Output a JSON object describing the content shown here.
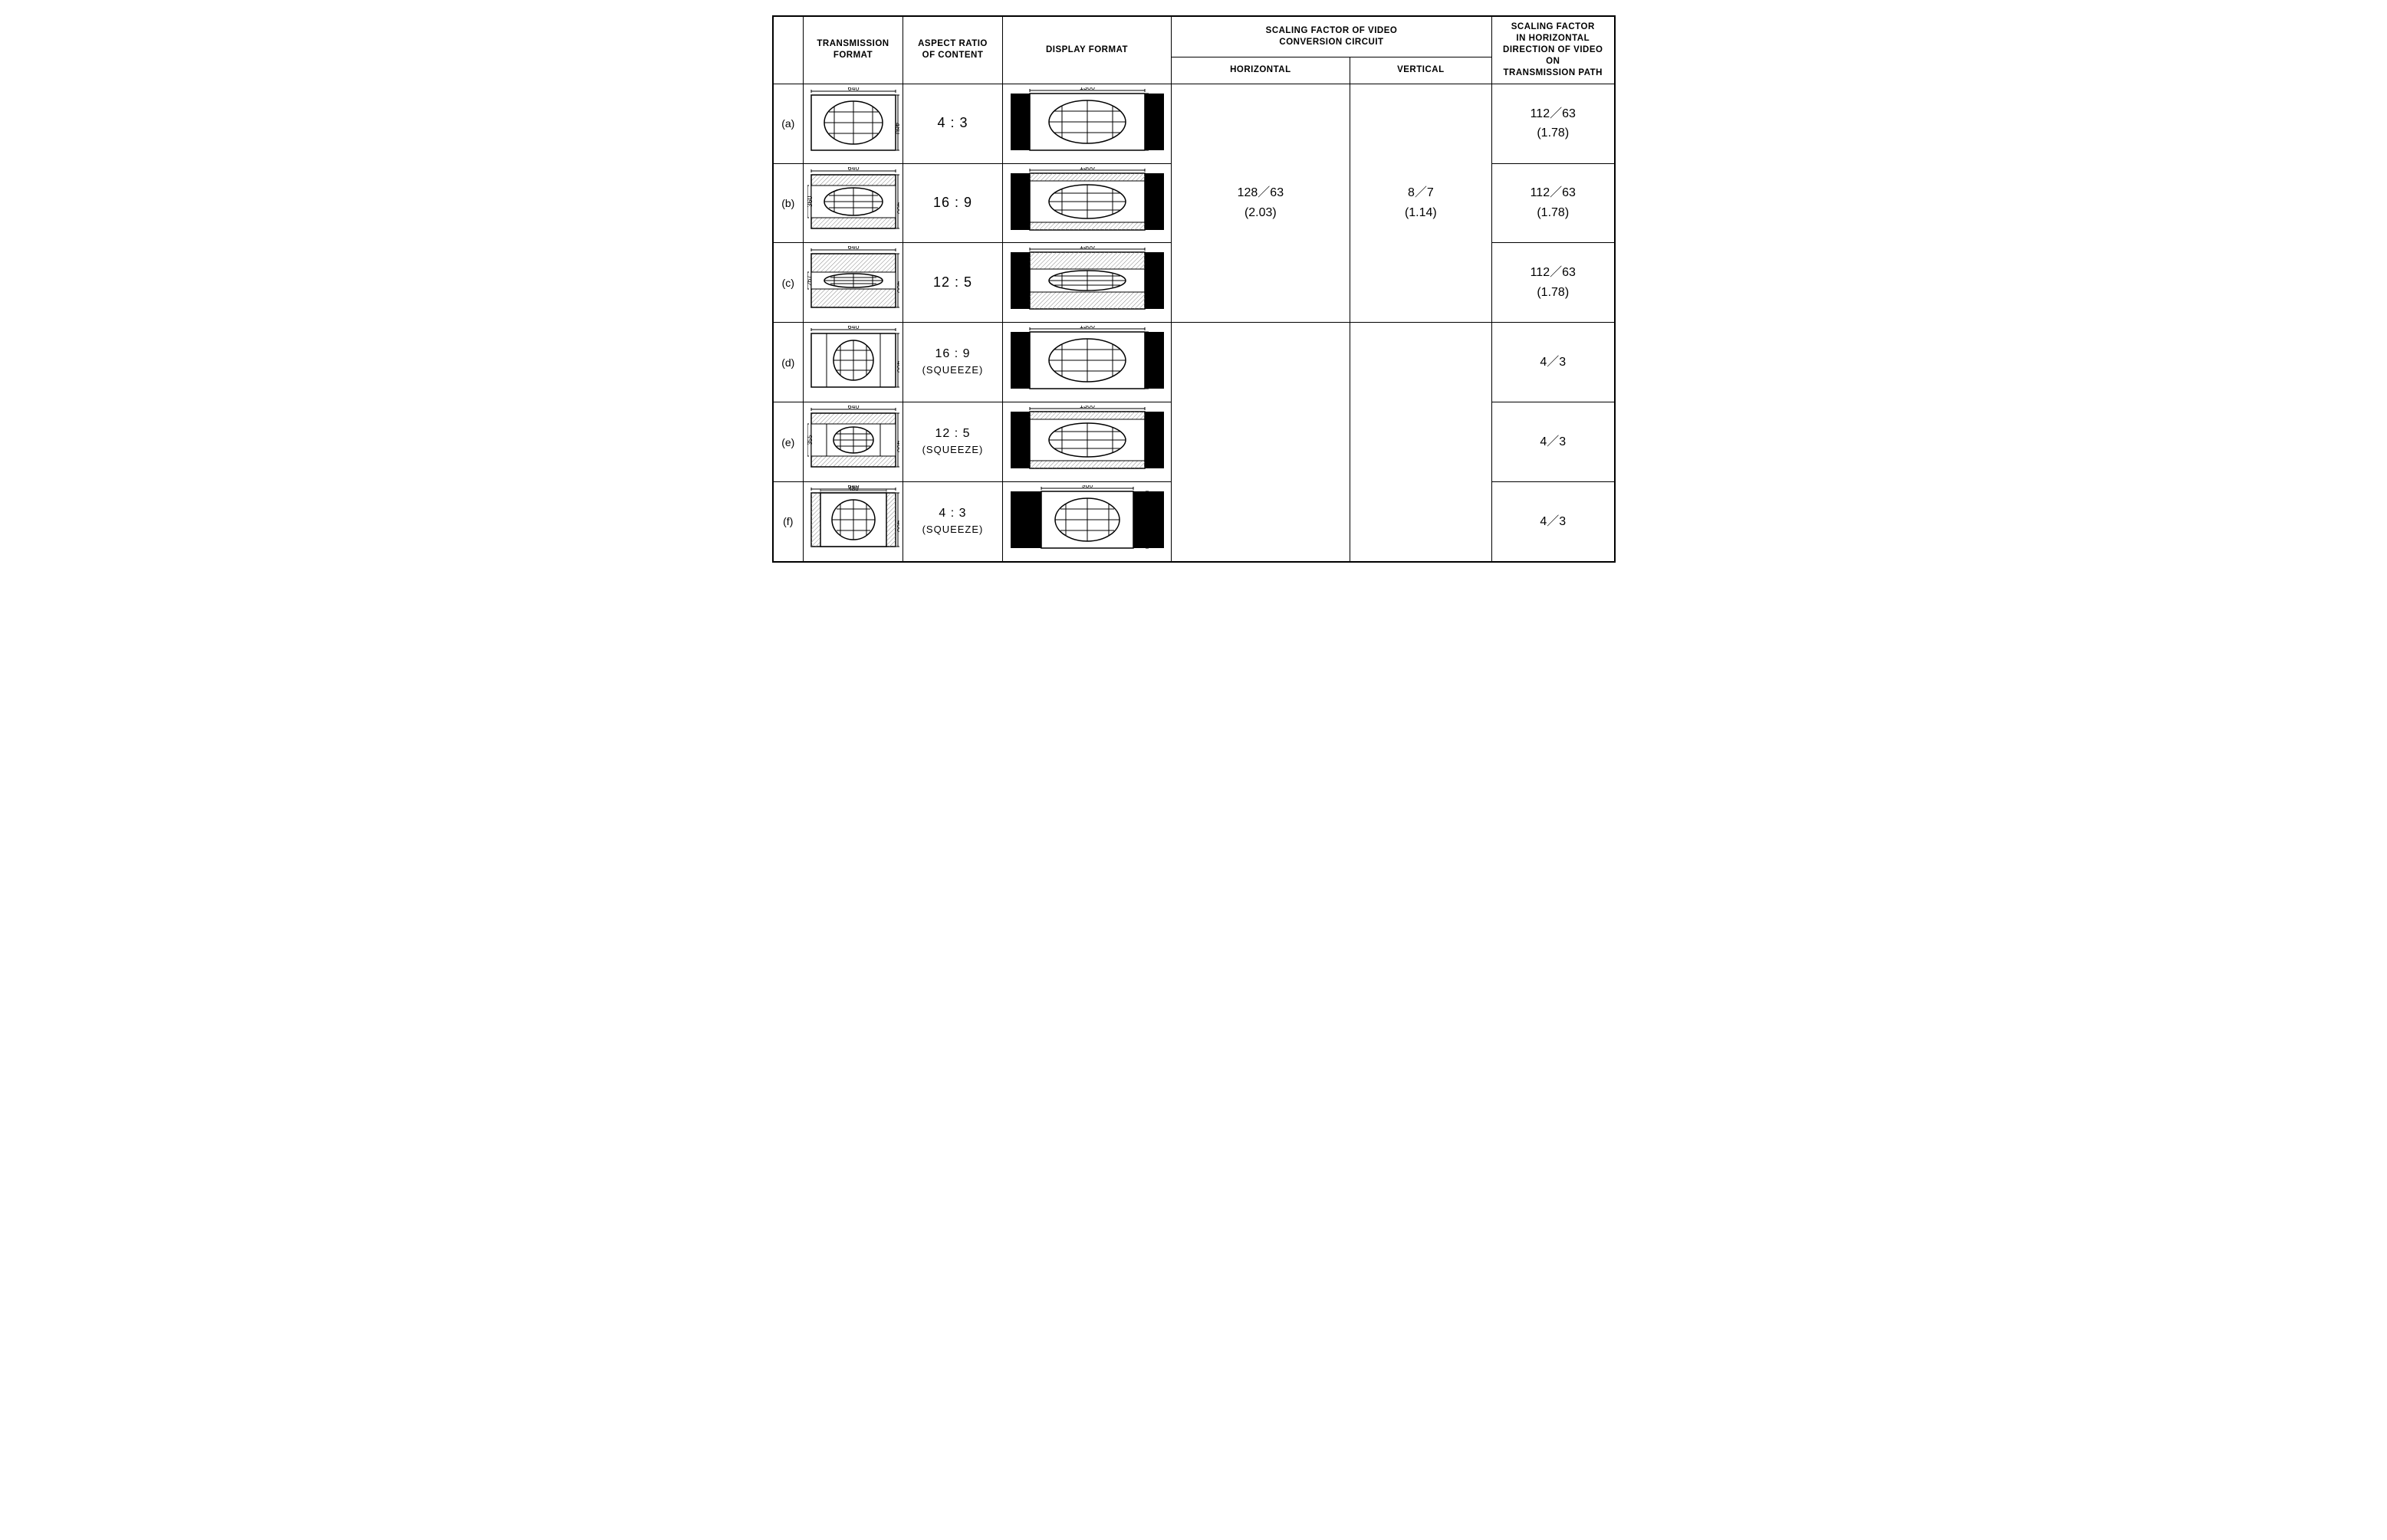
{
  "table": {
    "headers": {
      "col1": "TRANSMISSION\nFORMAT",
      "col2": "ASPECT RATIO\nOF CONTENT",
      "col3": "DISPLAY FORMAT",
      "col4_top": "SCALING FACTOR OF VIDEO\nCONVERSION CIRCUIT",
      "col4_h": "HORIZONTAL",
      "col4_v": "VERTICAL",
      "col5": "SCALING FACTOR\nIN HORIZONTAL\nDIRECTION OF VIDEO ON\nTRANSMISSION PATH"
    },
    "shared_scaling": {
      "horizontal": "128／63\n(2.03)",
      "vertical": "8／7\n(1.14)"
    },
    "rows": [
      {
        "label": "(a)",
        "aspect": "4 : 3",
        "scaling_h_path": "112／63\n(1.78)"
      },
      {
        "label": "(b)",
        "aspect": "16 : 9",
        "scaling_h_path": "112／63\n(1.78)"
      },
      {
        "label": "(c)",
        "aspect": "12 : 5",
        "scaling_h_path": "112／63\n(1.78)"
      },
      {
        "label": "(d)",
        "aspect": "16 : 9\n(SQUEEZE)",
        "scaling_h_path": "4／3"
      },
      {
        "label": "(e)",
        "aspect": "12 : 5\n(SQUEEZE)",
        "scaling_h_path": "4／3"
      },
      {
        "label": "(f)",
        "aspect": "4 : 3\n(SQUEEZE)",
        "scaling_h_path": "4／3"
      }
    ]
  }
}
